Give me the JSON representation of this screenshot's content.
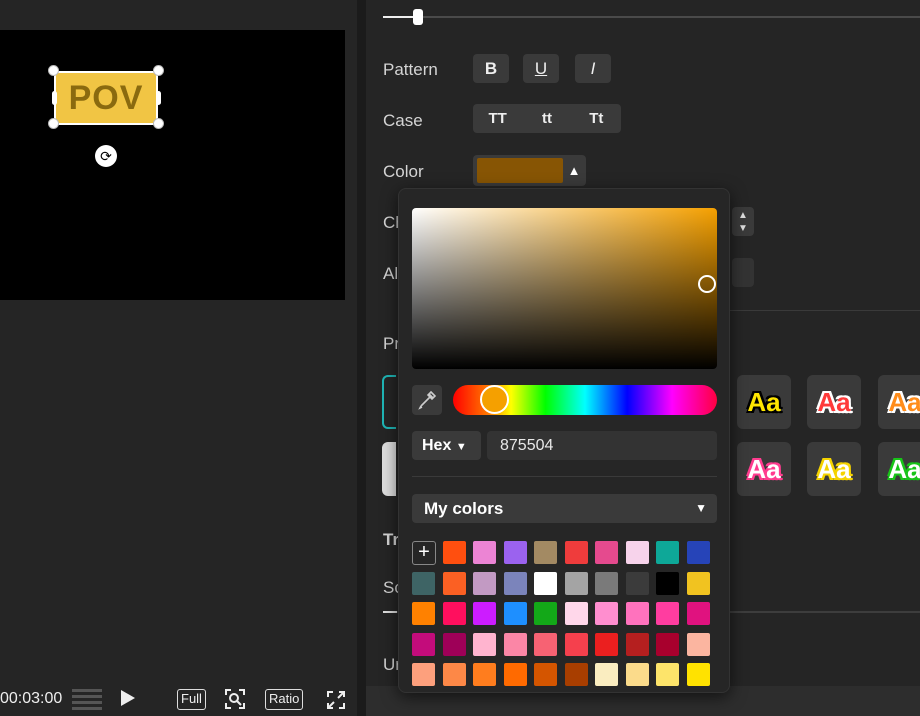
{
  "preview": {
    "sticker_text": "POV",
    "timecode": "00:03:00",
    "full_label": "Full",
    "ratio_label": "Ratio"
  },
  "properties": {
    "pattern_label": "Pattern",
    "pattern_buttons": [
      "B",
      "U",
      "I"
    ],
    "case_label": "Case",
    "case_buttons": [
      "TT",
      "tt",
      "Tt"
    ],
    "color_label": "Color",
    "color_value": "#875504",
    "partial_labels": [
      "Ch",
      "Al",
      "Pr",
      "Tr",
      "Sc",
      "Ur"
    ]
  },
  "presets": [
    {
      "text": "Aa",
      "fill": "#ffe600",
      "stroke": "#000"
    },
    {
      "text": "Aa",
      "fill": "#ff3a3a",
      "stroke": "#fff"
    },
    {
      "text": "Aa",
      "fill": "#ff8c1a",
      "stroke": "#fff"
    },
    {
      "text": "Aa",
      "fill": "#ffffff",
      "stroke": "#ff3c8f"
    },
    {
      "text": "Aa",
      "fill": "#ffffff",
      "stroke": "#f5d300"
    },
    {
      "text": "Aa",
      "fill": "#ffffff",
      "stroke": "#18c418"
    }
  ],
  "picker": {
    "hex_mode": "Hex",
    "hex_value": "875504",
    "mycolors_label": "My colors",
    "add_label": "+",
    "swatches": [
      [
        "#ff4f0f",
        "#ec84d4",
        "#9b62ef",
        "#a38a63",
        "#ef3c3c",
        "#e54a8e",
        "#f7d3eb",
        "#0ea898",
        "#2644b8"
      ],
      [
        "#3e6465",
        "#fb6023",
        "#c29ac3",
        "#7b84bb",
        "#ffffff",
        "#a4a4a4",
        "#7a7a7a",
        "#3b3b3b",
        "#000000",
        "#f1c320"
      ],
      [
        "#ff8100",
        "#ff0f5e",
        "#cc1cff",
        "#1e8fff",
        "#13a818",
        "#ffd7ea",
        "#ff8ecf",
        "#ff72bd",
        "#ff3da0",
        "#e0127f"
      ],
      [
        "#c30c7b",
        "#9e0058",
        "#ffb4cf",
        "#fb86a6",
        "#f76273",
        "#f5404d",
        "#eb1f1f",
        "#b51f1f",
        "#a8002d",
        "#fbb5a0"
      ],
      [
        "#fda07d",
        "#fd8847",
        "#ff7d1e",
        "#ff6a00",
        "#d45500",
        "#a83e00",
        "#faedc0",
        "#fbdb8b",
        "#fde46a",
        "#ffe200"
      ]
    ]
  }
}
